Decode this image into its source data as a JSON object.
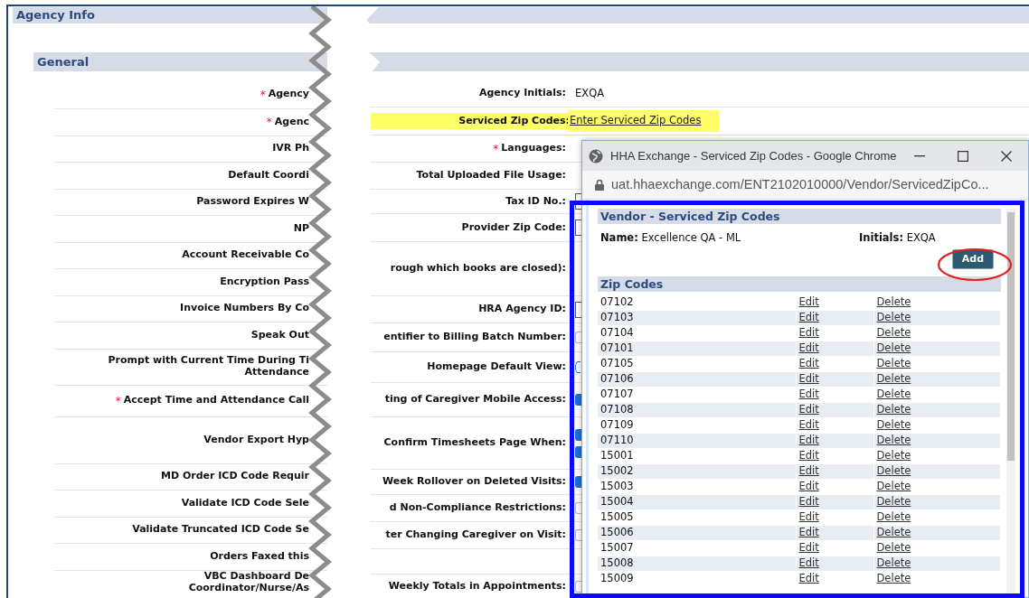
{
  "page": {
    "title": "Agency Info",
    "section": "General"
  },
  "left_fields": [
    {
      "label": "Agency",
      "mark": "*"
    },
    {
      "label": "Agenc",
      "mark": "*"
    },
    {
      "label": "IVR Ph"
    },
    {
      "label": "Default Coordi"
    },
    {
      "label": "Password Expires W"
    },
    {
      "label": "NP"
    },
    {
      "label": "Account Receivable Co"
    },
    {
      "label": "Encryption Pass"
    },
    {
      "label": "Invoice Numbers By Co"
    },
    {
      "label": "Speak Out"
    },
    {
      "label": "Prompt with Current Time During Ti\nAttendance"
    },
    {
      "label": "Accept Time and Attendance Call",
      "mark": "*"
    },
    {
      "label": "Vendor Export Hyp"
    },
    {
      "label": "MD Order ICD Code Requir"
    },
    {
      "label": "Validate ICD Code Sele"
    },
    {
      "label": "Validate Truncated ICD Code Se"
    },
    {
      "label": "Orders Faxed this"
    },
    {
      "label": "VBC Dashboard De\nCoordinator/Nurse/As"
    }
  ],
  "right_fields": [
    {
      "label": "Agency Initials:",
      "kind": "text",
      "value": "EXQA",
      "highlighted": false
    },
    {
      "label": "Serviced Zip Codes:",
      "kind": "link",
      "value": "Enter Serviced Zip Codes",
      "highlighted": true
    },
    {
      "label": "Languages:",
      "mark": "*",
      "kind": "none",
      "highlighted": false
    },
    {
      "label": "Total Uploaded File Usage:",
      "kind": "none",
      "highlighted": false
    },
    {
      "label": "Tax ID No.:",
      "kind": "field",
      "highlighted": false
    },
    {
      "label": "Provider Zip Code:",
      "kind": "field",
      "highlighted": false
    },
    {
      "label": "rough which books are closed):",
      "kind": "none",
      "highlighted": false
    },
    {
      "label": "HRA Agency ID:",
      "kind": "field",
      "highlighted": false
    },
    {
      "label": "entifier to Billing Batch Number:",
      "kind": "checkboxes",
      "checks": [
        false
      ],
      "highlighted": false
    },
    {
      "label": "Homepage Default View:",
      "kind": "radio",
      "checked": false,
      "highlighted": false
    },
    {
      "label": "ting of Caregiver Mobile Access:",
      "kind": "checkboxes",
      "checks": [
        true
      ],
      "highlighted": false
    },
    {
      "label": "Confirm Timesheets Page When:",
      "kind": "checkboxes",
      "checks": [
        true,
        true
      ],
      "highlighted": false
    },
    {
      "label": "Week Rollover on Deleted Visits:",
      "kind": "checkboxes",
      "checks": [
        true
      ],
      "highlighted": false
    },
    {
      "label": "d Non-Compliance Restrictions:",
      "kind": "checkboxes",
      "checks": [
        false
      ],
      "highlighted": false
    },
    {
      "label": "ter Changing Caregiver on Visit:",
      "kind": "checkboxes",
      "checks": [
        false
      ],
      "highlighted": false
    },
    {
      "kind": "blank",
      "highlighted": false
    },
    {
      "label": "Weekly Totals in Appointments:",
      "kind": "checkboxes",
      "checks": [
        false
      ],
      "highlighted": false
    }
  ],
  "popup": {
    "window_title": "HHA Exchange - Serviced Zip Codes - Google Chrome",
    "address": "uat.hhaexchange.com/ENT2102010000/Vendor/ServicedZipCo...",
    "heading": "Vendor - Serviced Zip Codes",
    "name": "**Name:** Excellence QA - ML",
    "initials": "**Initials:** EXQA",
    "add_button": "Add",
    "table_title": "Zip Codes",
    "rows": [
      {
        "zip": "07102",
        "edit": "Edit",
        "delete": "Delete"
      },
      {
        "zip": "07103",
        "edit": "Edit",
        "delete": "Delete"
      },
      {
        "zip": "07104",
        "edit": "Edit",
        "delete": "Delete"
      },
      {
        "zip": "07101",
        "edit": "Edit",
        "delete": "Delete"
      },
      {
        "zip": "07105",
        "edit": "Edit",
        "delete": "Delete"
      },
      {
        "zip": "07106",
        "edit": "Edit",
        "delete": "Delete"
      },
      {
        "zip": "07107",
        "edit": "Edit",
        "delete": "Delete"
      },
      {
        "zip": "07108",
        "edit": "Edit",
        "delete": "Delete"
      },
      {
        "zip": "07109",
        "edit": "Edit",
        "delete": "Delete"
      },
      {
        "zip": "07110",
        "edit": "Edit",
        "delete": "Delete"
      },
      {
        "zip": "15001",
        "edit": "Edit",
        "delete": "Delete"
      },
      {
        "zip": "15002",
        "edit": "Edit",
        "delete": "Delete"
      },
      {
        "zip": "15003",
        "edit": "Edit",
        "delete": "Delete"
      },
      {
        "zip": "15004",
        "edit": "Edit",
        "delete": "Delete"
      },
      {
        "zip": "15005",
        "edit": "Edit",
        "delete": "Delete"
      },
      {
        "zip": "15006",
        "edit": "Edit",
        "delete": "Delete"
      },
      {
        "zip": "15007",
        "edit": "Edit",
        "delete": "Delete"
      },
      {
        "zip": "15008",
        "edit": "Edit",
        "delete": "Delete"
      },
      {
        "zip": "15009",
        "edit": "Edit",
        "delete": "Delete"
      }
    ]
  }
}
